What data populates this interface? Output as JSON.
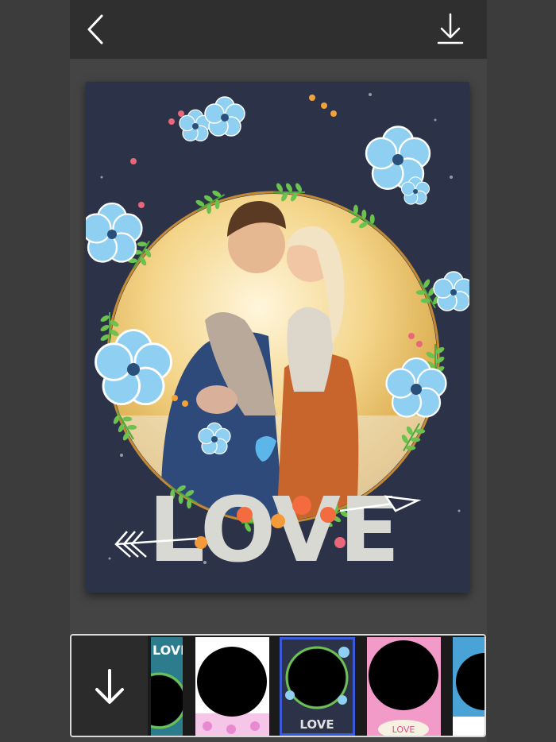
{
  "toolbar": {
    "back_icon": "chevron-left-icon",
    "download_icon": "download-icon"
  },
  "frame": {
    "word": "LOVE",
    "background_color": "#2c3349",
    "wreath_leaf_color": "#5fb848",
    "flower_color": "#8fd0f2",
    "flower_center_color": "#2a4f7a"
  },
  "thumbnails": {
    "download_icon": "download-arrow-icon",
    "items": [
      {
        "label": "LOVE",
        "selected": false
      },
      {
        "label": "",
        "selected": false
      },
      {
        "label": "LOVE",
        "selected": true
      },
      {
        "label": "LOVE",
        "selected": false
      },
      {
        "label": "",
        "selected": false
      }
    ],
    "selected_border_color": "#3a5bd9"
  }
}
